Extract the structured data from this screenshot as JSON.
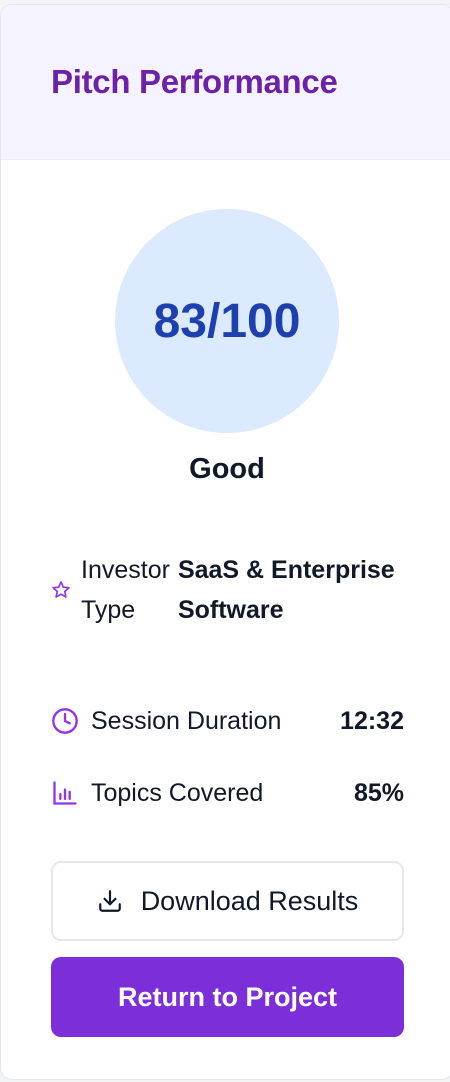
{
  "card": {
    "title": "Pitch Performance"
  },
  "score": {
    "value": "83/100",
    "rating": "Good"
  },
  "stats": {
    "investor_type": {
      "label": "Investor Type",
      "value": "SaaS & Enterprise Software",
      "icon": "star-icon"
    },
    "session_duration": {
      "label": "Session Duration",
      "value": "12:32",
      "icon": "clock-icon"
    },
    "topics_covered": {
      "label": "Topics Covered",
      "value": "85%",
      "icon": "bar-chart-icon"
    }
  },
  "actions": {
    "download_label": "Download Results",
    "download_icon": "download-icon",
    "return_label": "Return to Project"
  },
  "colors": {
    "accent": "#7c2fd9",
    "title": "#6b21a8",
    "score_text": "#1e40af",
    "score_bg": "#dbeafe",
    "header_bg": "#f5f3ff"
  }
}
